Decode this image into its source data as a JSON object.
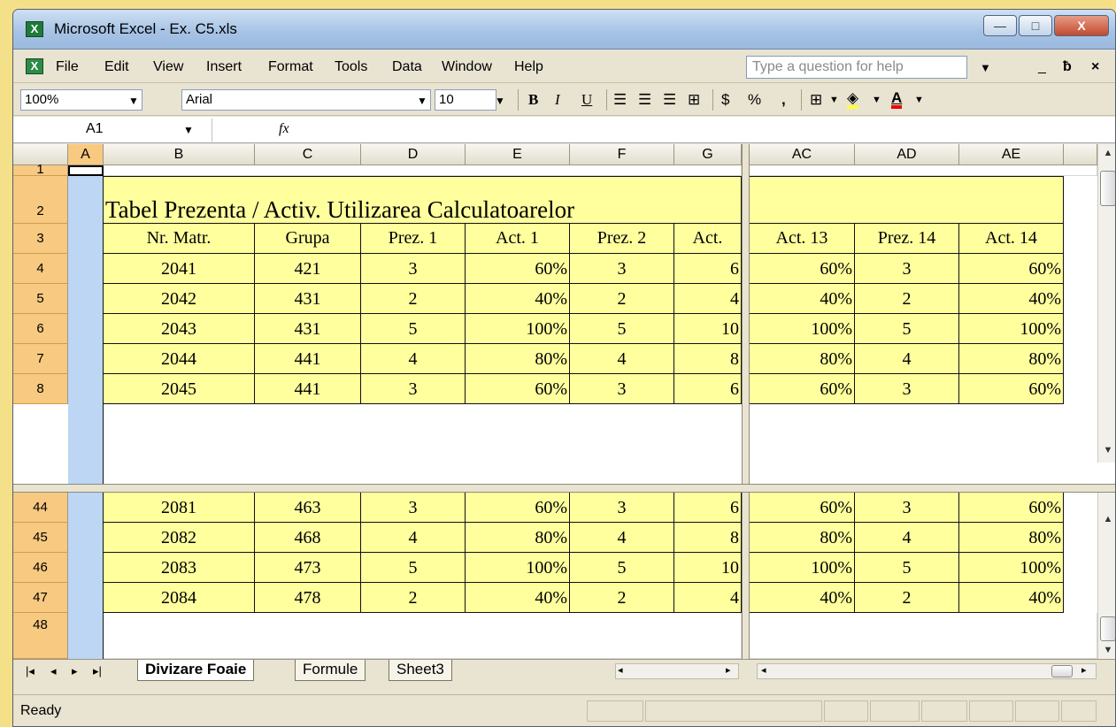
{
  "window": {
    "title": "Microsoft Excel - Ex. C5.xls",
    "app_icon": "X",
    "min_label": "—",
    "max_label": "□",
    "close_label": "X"
  },
  "menu": {
    "items": [
      "File",
      "Edit",
      "View",
      "Insert",
      "Format",
      "Tools",
      "Data",
      "Window",
      "Help"
    ],
    "help_placeholder": "Type a question for help",
    "doc_min": "_",
    "doc_restore": "ƀ",
    "doc_close": "×"
  },
  "toolbar": {
    "zoom": "100%",
    "font": "Arial",
    "size": "10",
    "bold": "B",
    "italic": "I",
    "underline": "U",
    "currency": "$",
    "percent": "%",
    "comma": ","
  },
  "formula": {
    "name_box": "A1",
    "fx": "fx",
    "content": ""
  },
  "sheet": {
    "left_columns": [
      "A",
      "B",
      "C",
      "D",
      "E",
      "F",
      "G"
    ],
    "right_columns": [
      "AC",
      "AD",
      "AE"
    ],
    "title": "Tabel Prezenta / Activ. Utilizarea Calculatoarelor",
    "headers_left": [
      "Nr. Matr.",
      "Grupa",
      "Prez. 1",
      "Act. 1",
      "Prez. 2",
      "Act."
    ],
    "headers_right": [
      "Act. 13",
      "Prez. 14",
      "Act. 14"
    ],
    "top_rows": [
      {
        "row": "4",
        "left": [
          "2041",
          "421",
          "3",
          "60%",
          "3",
          "6"
        ],
        "right": [
          "60%",
          "3",
          "60%"
        ]
      },
      {
        "row": "5",
        "left": [
          "2042",
          "431",
          "2",
          "40%",
          "2",
          "4"
        ],
        "right": [
          "40%",
          "2",
          "40%"
        ]
      },
      {
        "row": "6",
        "left": [
          "2043",
          "431",
          "5",
          "100%",
          "5",
          "10"
        ],
        "right": [
          "100%",
          "5",
          "100%"
        ]
      },
      {
        "row": "7",
        "left": [
          "2044",
          "441",
          "4",
          "80%",
          "4",
          "8"
        ],
        "right": [
          "80%",
          "4",
          "80%"
        ]
      },
      {
        "row": "8",
        "left": [
          "2045",
          "441",
          "3",
          "60%",
          "3",
          "6"
        ],
        "right": [
          "60%",
          "3",
          "60%"
        ]
      }
    ],
    "bottom_rows": [
      {
        "row": "44",
        "left": [
          "2081",
          "463",
          "3",
          "60%",
          "3",
          "6"
        ],
        "right": [
          "60%",
          "3",
          "60%"
        ]
      },
      {
        "row": "45",
        "left": [
          "2082",
          "468",
          "4",
          "80%",
          "4",
          "8"
        ],
        "right": [
          "80%",
          "4",
          "80%"
        ]
      },
      {
        "row": "46",
        "left": [
          "2083",
          "473",
          "5",
          "100%",
          "5",
          "10"
        ],
        "right": [
          "100%",
          "5",
          "100%"
        ]
      },
      {
        "row": "47",
        "left": [
          "2084",
          "478",
          "2",
          "40%",
          "2",
          "4"
        ],
        "right": [
          "40%",
          "2",
          "40%"
        ]
      }
    ],
    "row_labels": {
      "r1": "1",
      "r2": "2",
      "r3": "3",
      "r48": "48"
    }
  },
  "tabs": {
    "items": [
      "Divizare Foaie",
      "Formule",
      "Sheet3"
    ],
    "active": "Divizare Foaie",
    "nav": [
      "|◂",
      "◂",
      "▸",
      "▸|"
    ]
  },
  "status": {
    "text": "Ready"
  },
  "colors": {
    "cell_fill": "#ffff9e",
    "row_header": "#f8c980",
    "title_bar": "#a7c4e6"
  }
}
